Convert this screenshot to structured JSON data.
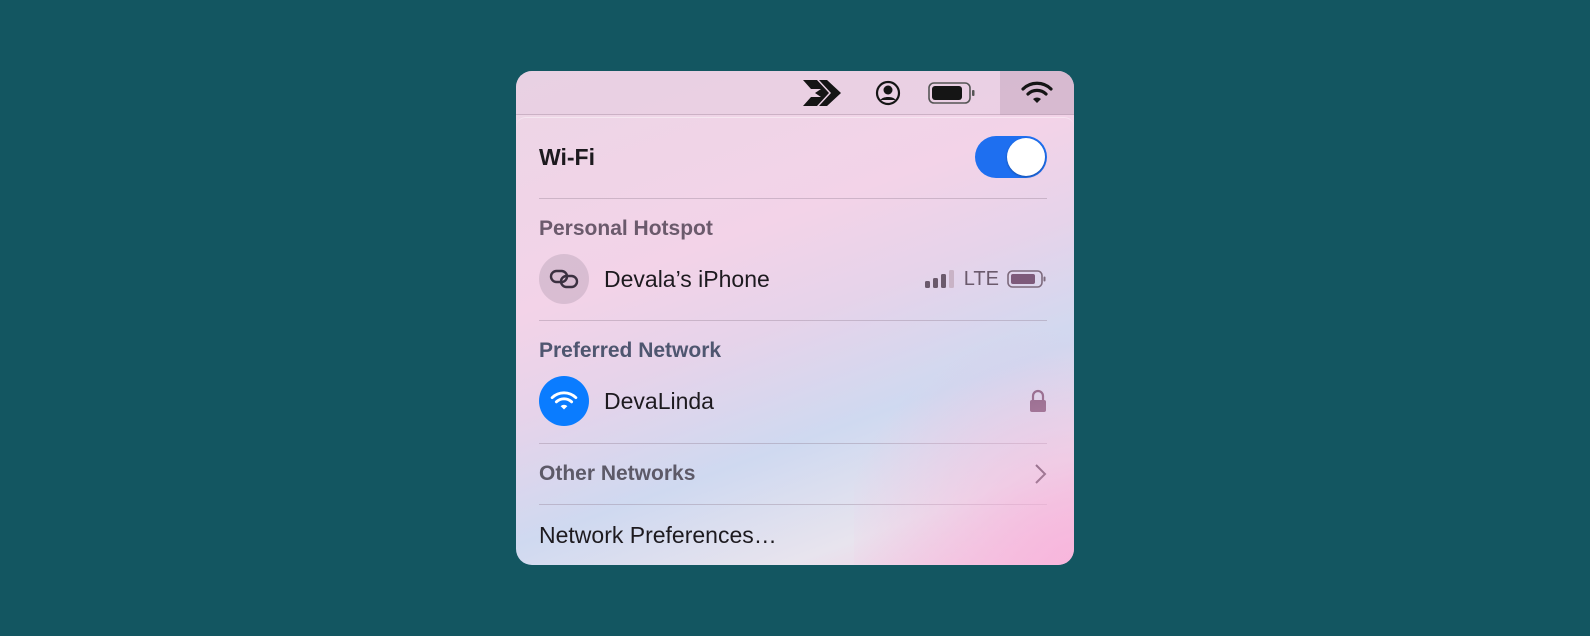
{
  "menubar": {
    "icons": [
      "arrow-app-icon",
      "user-circle-icon",
      "battery-icon",
      "wifi-icon"
    ]
  },
  "wifi": {
    "title": "Wi-Fi",
    "enabled": true,
    "toggle_color": "#1e6ff0"
  },
  "hotspot": {
    "heading": "Personal Hotspot",
    "device": "Devala’s iPhone",
    "signal_bars": 3,
    "signal_max": 4,
    "network": "LTE",
    "icon": "link-icon"
  },
  "preferred": {
    "heading": "Preferred Network",
    "network": "DevaLinda",
    "secured": true,
    "icon_color": "#0a7cff"
  },
  "other": {
    "label": "Other Networks"
  },
  "prefs": {
    "label": "Network Preferences…"
  }
}
